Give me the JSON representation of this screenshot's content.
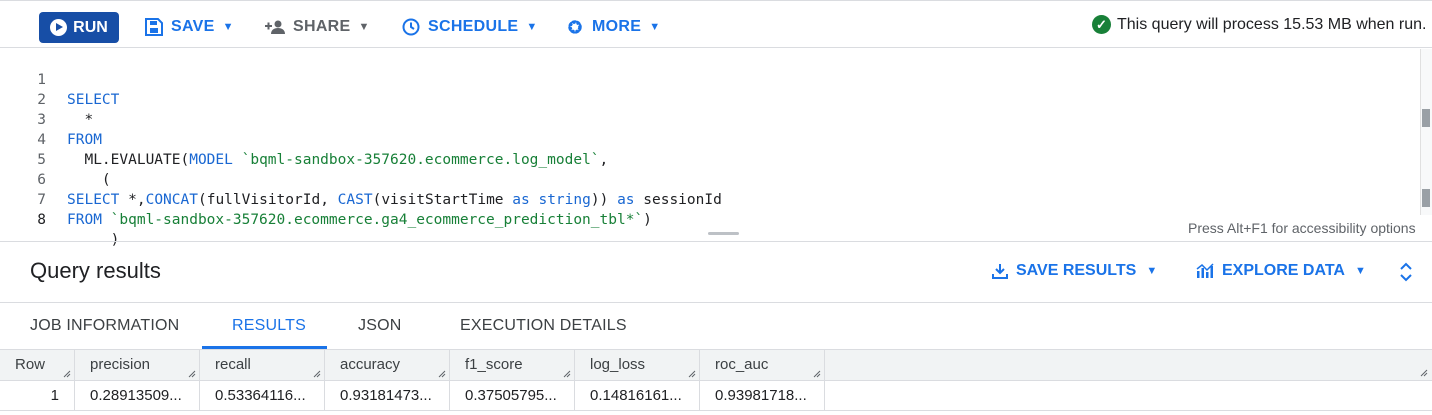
{
  "toolbar": {
    "run_label": "RUN",
    "save_label": "SAVE",
    "share_label": "SHARE",
    "schedule_label": "SCHEDULE",
    "more_label": "MORE",
    "status_text": "This query will process 15.53 MB when run."
  },
  "editor": {
    "line_numbers": [
      "1",
      "2",
      "3",
      "4",
      "5",
      "6",
      "7",
      "8"
    ],
    "lines": {
      "l1_kw": "SELECT",
      "l2": "  *",
      "l3_kw": "FROM",
      "l4_fn": "  ML.EVALUATE(",
      "l4_kw": "MODEL",
      "l4_str": " `bqml-sandbox-357620.ecommerce.log_model`",
      "l4_end": ",",
      "l5": "    (",
      "l6_kw1": "SELECT",
      "l6_a": " *,",
      "l6_kw2": "CONCAT",
      "l6_b": "(fullVisitorId, ",
      "l6_kw3": "CAST",
      "l6_c": "(visitStartTime ",
      "l6_kw4": "as string",
      "l6_d": ")) ",
      "l6_kw5": "as",
      "l6_e": " sessionId",
      "l7_kw": "FROM",
      "l7_str": " `bqml-sandbox-357620.ecommerce.ga4_ecommerce_prediction_tbl*`",
      "l7_end": ")",
      "l8": "     )"
    },
    "accessibility_hint": "Press Alt+F1 for accessibility options"
  },
  "results": {
    "title": "Query results",
    "save_results_label": "SAVE RESULTS",
    "explore_data_label": "EXPLORE DATA",
    "tabs": [
      {
        "label": "JOB INFORMATION"
      },
      {
        "label": "RESULTS"
      },
      {
        "label": "JSON"
      },
      {
        "label": "EXECUTION DETAILS"
      }
    ],
    "columns": [
      "Row",
      "precision",
      "recall",
      "accuracy",
      "f1_score",
      "log_loss",
      "roc_auc"
    ],
    "rows": [
      [
        "1",
        "0.28913509...",
        "0.53364116...",
        "0.93181473...",
        "0.37505795...",
        "0.14816161...",
        "0.93981718..."
      ]
    ]
  },
  "colors": {
    "accent": "#1a73e8",
    "run_button": "#174ea6",
    "success": "#188038"
  }
}
